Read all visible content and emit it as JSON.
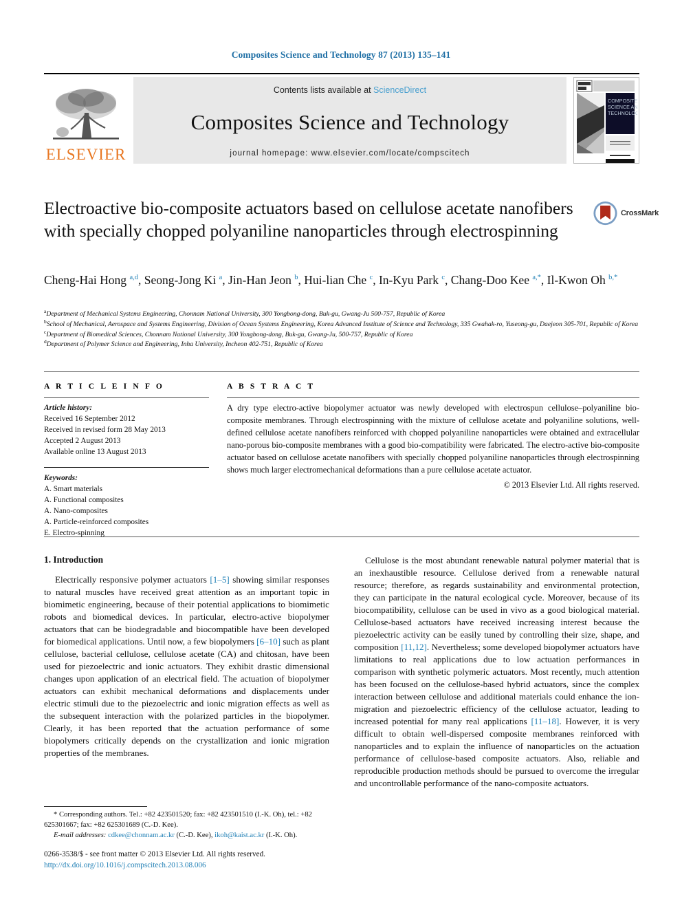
{
  "running_head": "Composites Science and Technology 87 (2013) 135–141",
  "masthead": {
    "publisher_logo_text": "ELSEVIER",
    "contents_prefix": "Contents lists available at",
    "contents_link": "ScienceDirect",
    "journal_name": "Composites Science and Technology",
    "homepage_line": "journal homepage: www.elsevier.com/locate/compscitech",
    "cover_title_lines": [
      "COMPOSITES",
      "SCIENCE AND",
      "TECHNOLOGY"
    ]
  },
  "article": {
    "title": "Electroactive bio-composite actuators based on cellulose acetate nanofibers with specially chopped polyaniline nanoparticles through electrospinning",
    "crossmark_label": "CrossMark",
    "authors_html": "Cheng-Hai Hong <sup>a,d</sup>, Seong-Jong Ki <sup>a</sup>, Jin-Han Jeon <sup>b</sup>, Hui-lian Che <sup>c</sup>, In-Kyu Park <sup>c</sup>, Chang-Doo Kee <sup>a,*</sup>, Il-Kwon Oh <sup>b,*</sup>",
    "affiliations": [
      {
        "marker": "a",
        "text": "Department of Mechanical Systems Engineering, Chonnam National University, 300 Yongbong-dong, Buk-gu, Gwang-Ju 500-757, Republic of Korea"
      },
      {
        "marker": "b",
        "text": "School of Mechanical, Aerospace and Systems Engineering, Division of Ocean Systems Engineering, Korea Advanced Institute of Science and Technology, 335 Gwahak-ro, Yuseong-gu, Daejeon 305-701, Republic of Korea"
      },
      {
        "marker": "c",
        "text": "Department of Biomedical Sciences, Chonnam National University, 300 Yongbong-dong, Buk-gu, Gwang-Ju, 500-757, Republic of Korea"
      },
      {
        "marker": "d",
        "text": "Department of Polymer Science and Engineering, Inha University, Incheon 402-751, Republic of Korea"
      }
    ]
  },
  "article_info": {
    "heading": "A R T I C L E    I N F O",
    "history_label": "Article history:",
    "history": [
      "Received 16 September 2012",
      "Received in revised form 28 May 2013",
      "Accepted 2 August 2013",
      "Available online 13 August 2013"
    ],
    "keywords_label": "Keywords:",
    "keywords": [
      "A. Smart materials",
      "A. Functional composites",
      "A. Nano-composites",
      "A. Particle-reinforced composites",
      "E. Electro-spinning"
    ]
  },
  "abstract": {
    "heading": "A B S T R A C T",
    "text": "A dry type electro-active biopolymer actuator was newly developed with electrospun cellulose–polyaniline bio-composite membranes. Through electrospinning with the mixture of cellulose acetate and polyaniline solutions, well-defined cellulose acetate nanofibers reinforced with chopped polyaniline nanoparticles were obtained and extracellular nano-porous bio-composite membranes with a good bio-compatibility were fabricated. The electro-active bio-composite actuator based on cellulose acetate nanofibers with specially chopped polyaniline nanoparticles through electrospinning shows much larger electromechanical deformations than a pure cellulose acetate actuator.",
    "copyright": "© 2013 Elsevier Ltd. All rights reserved."
  },
  "body": {
    "section_title": "1. Introduction",
    "left_paragraphs": [
      "Electrically responsive polymer actuators [1–5] showing similar responses to natural muscles have received great attention as an important topic in biomimetic engineering, because of their potential applications to biomimetic robots and biomedical devices. In particular, electro-active biopolymer actuators that can be biodegradable and biocompatible have been developed for biomedical applications. Until now, a few biopolymers [6–10] such as plant cellulose, bacterial cellulose, cellulose acetate (CA) and chitosan, have been used for piezoelectric and ionic actuators. They exhibit drastic dimensional changes upon application of an electrical field. The actuation of biopolymer actuators can exhibit mechanical deformations and displacements under electric stimuli due to the piezoelectric and ionic migration effects as well as the subsequent interaction with the polarized particles in the biopolymer. Clearly, it has been reported that the actuation performance of some biopolymers critically depends on the crystallization and ionic migration properties of the membranes."
    ],
    "right_paragraphs": [
      "Cellulose is the most abundant renewable natural polymer material that is an inexhaustible resource. Cellulose derived from a renewable natural resource; therefore, as regards sustainability and environmental protection, they can participate in the natural ecological cycle. Moreover, because of its biocompatibility, cellulose can be used in vivo as a good biological material. Cellulose-based actuators have received increasing interest because the piezoelectric activity can be easily tuned by controlling their size, shape, and composition [11,12]. Nevertheless; some developed biopolymer actuators have limitations to real applications due to low actuation performances in comparison with synthetic polymeric actuators. Most recently, much attention has been focused on the cellulose-based hybrid actuators, since the complex interaction between cellulose and additional materials could enhance the ion-migration and piezoelectric efficiency of the cellulose actuator, leading to increased potential for many real applications [11–18]. However, it is very difficult to obtain well-dispersed composite membranes reinforced with nanoparticles and to explain the influence of nanoparticles on the actuation performance of cellulose-based composite actuators. Also, reliable and reproducible production methods should be pursued to overcome the irregular and uncontrollable performance of the nano-composite actuators."
    ]
  },
  "footnotes": {
    "corresponding": "* Corresponding authors. Tel.: +82 423501520; fax: +82 423501510 (I.-K. Oh), tel.: +82 625301667; fax: +82 625301689 (C.-D. Kee).",
    "email_label": "E-mail addresses:",
    "email_1": "cdkee@chonnam.ac.kr",
    "email_1_owner": "(C.-D. Kee),",
    "email_2": "ikoh@kaist.ac.kr",
    "email_2_owner": "(I.-K. Oh)."
  },
  "imprint": {
    "line1": "0266-3538/$ - see front matter © 2013 Elsevier Ltd. All rights reserved.",
    "doi": "http://dx.doi.org/10.1016/j.compscitech.2013.08.006"
  },
  "colors": {
    "link_blue": "#1f7fb5",
    "running_head_blue": "#1f6fa5",
    "elsevier_orange": "#E87722",
    "band_gray": "#e8e8e8",
    "sciencedirect_blue": "#4aa0cf"
  }
}
